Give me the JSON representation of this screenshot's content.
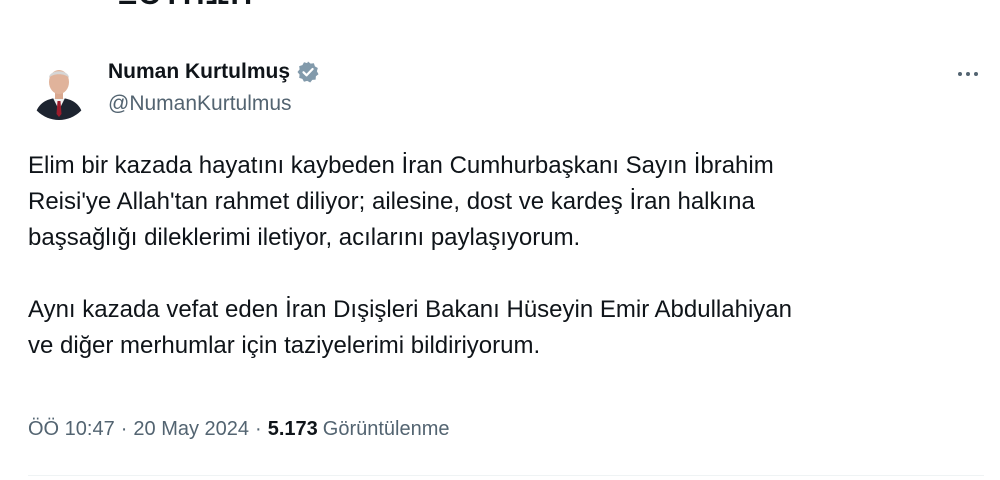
{
  "previous_fragment": "ΞΟΥΠΩΠ",
  "tweet": {
    "author": {
      "name": "Numan Kurtulmuş",
      "handle": "@NumanKurtulmus",
      "verified": true,
      "verified_color": "#829aab",
      "avatar_icon": "profile-photo"
    },
    "more_icon": "more-horizontal-icon",
    "paragraphs": [
      "Elim bir kazada hayatını kaybeden İran Cumhurbaşkanı Sayın İbrahim\nReisi'ye Allah'tan rahmet diliyor; ailesine, dost ve kardeş İran halkına\nbaşsağlığı dileklerimi iletiyor, acılarını paylaşıyorum.",
      "Aynı kazada vefat eden İran Dışişleri Bakanı Hüseyin Emir Abdullahiyan\nve diğer merhumlar için taziyelerimi bildiriyorum."
    ],
    "meta": {
      "time": "ÖÖ 10:47",
      "separator": "·",
      "date": "20 May 2024",
      "views_count": "5.173",
      "views_label": "Görüntülenme"
    }
  },
  "colors": {
    "text_primary": "#0f1419",
    "text_secondary": "#536471",
    "divider": "#eff3f4"
  }
}
